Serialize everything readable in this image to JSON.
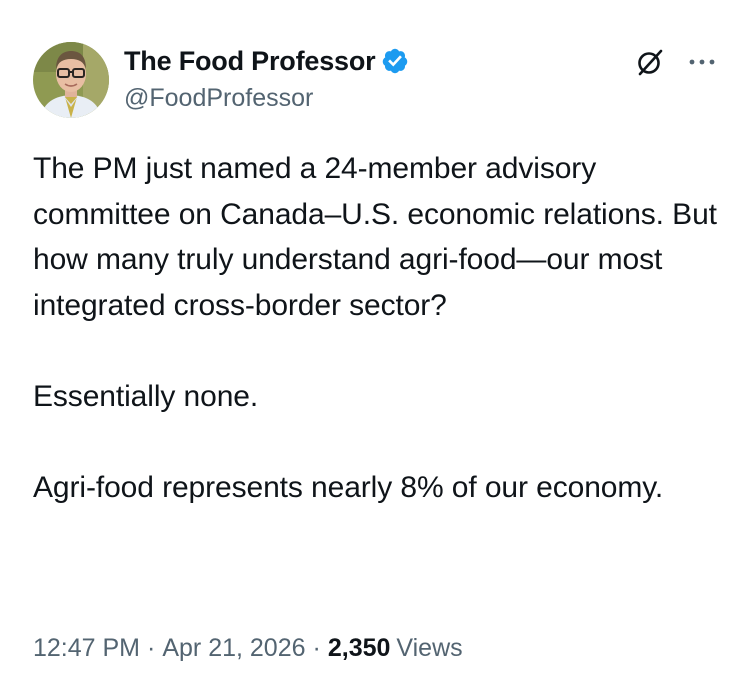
{
  "author": {
    "display_name": "The Food Professor",
    "handle": "@FoodProfessor",
    "verified": true
  },
  "tweet": {
    "paragraphs": [
      "The PM just named a 24-member advisory committee on Canada–U.S. economic relations. But how many truly understand agri-food—our most integrated cross-border sector?",
      "Essentially none.",
      "Agri-food represents nearly 8% of our economy."
    ]
  },
  "meta": {
    "time": "12:47 PM",
    "separator": "·",
    "date": "Apr 21, 2026",
    "views_count": "2,350",
    "views_label": "Views"
  },
  "icons": {
    "verified": "verified-badge-icon",
    "grok": "grok-icon",
    "more": "more-icon"
  },
  "colors": {
    "verified_blue": "#1d9bf0",
    "text_primary": "#0f1419",
    "text_secondary": "#536471"
  }
}
